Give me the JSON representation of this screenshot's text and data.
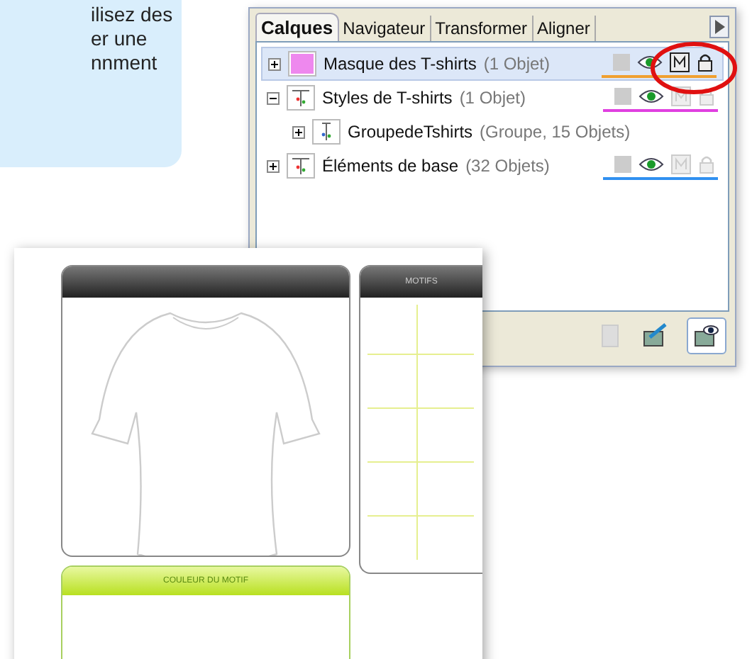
{
  "intro_note": {
    "lines": [
      "ilisez des",
      "er une",
      "nnment"
    ]
  },
  "layers_panel": {
    "tabs": [
      {
        "label": "Calques",
        "selected": true
      },
      {
        "label": "Navigateur",
        "selected": false
      },
      {
        "label": "Transformer",
        "selected": false
      },
      {
        "label": "Aligner",
        "selected": false
      }
    ],
    "layers": [
      {
        "name": "Masque des T-shirts",
        "count": "(1 Objet)",
        "kind": "swatch",
        "selected": true,
        "expanded": false,
        "visible": true,
        "active_tools": true,
        "color": "#f0a030"
      },
      {
        "name": "Styles de T-shirts",
        "count": "(1 Objet)",
        "kind": "drawing",
        "selected": false,
        "expanded": true,
        "visible": true,
        "active_tools": false,
        "color": "#e040e0",
        "children": [
          {
            "name": "GroupedeTshirts",
            "count": "(Groupe, 15 Objets)",
            "expanded": false
          }
        ]
      },
      {
        "name": "Éléments de base",
        "count": "(32 Objets)",
        "kind": "drawing",
        "selected": false,
        "expanded": false,
        "visible": true,
        "active_tools": false,
        "color": "#3090f0"
      }
    ],
    "tools": [
      {
        "kind": "page",
        "selected": false
      },
      {
        "kind": "edit",
        "selected": false
      },
      {
        "kind": "view",
        "selected": true
      }
    ]
  },
  "mockup": {
    "motifs_title": "MOTIFS",
    "color_title": "COULEUR DU MOTIF"
  }
}
